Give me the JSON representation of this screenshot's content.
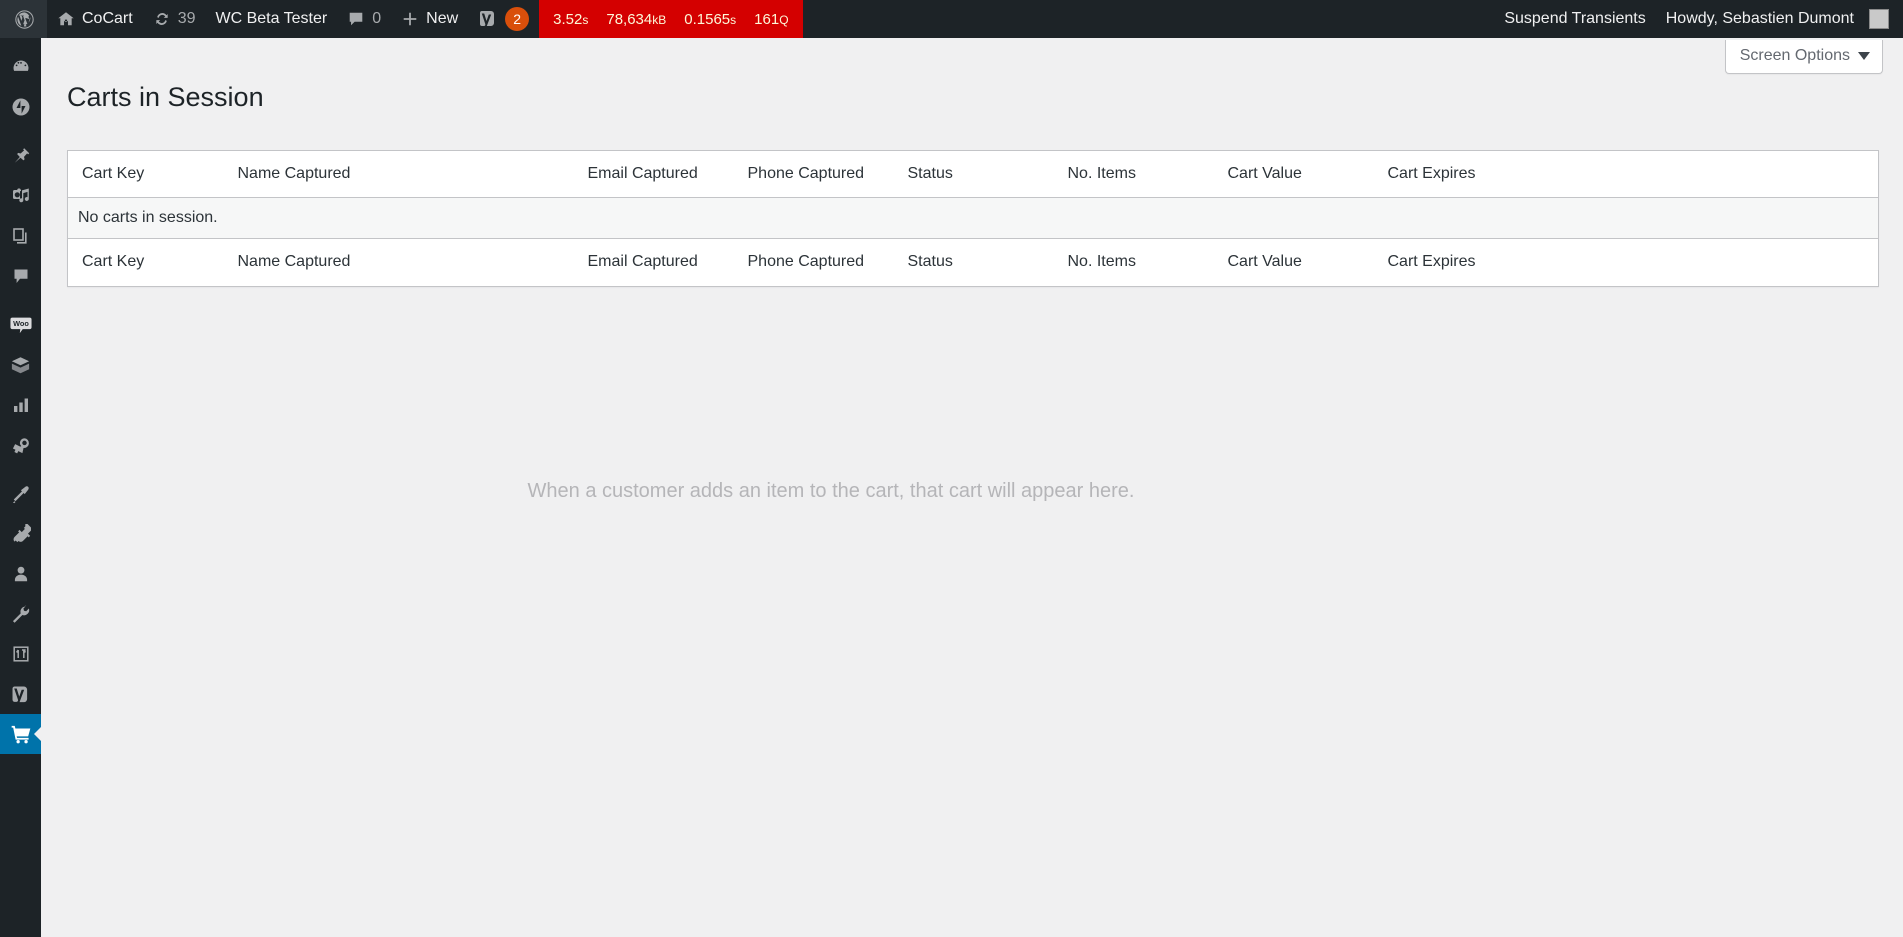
{
  "adminbar": {
    "wp_logo": "wordpress-logo-icon",
    "site_name": "CoCart",
    "home_icon": "home-icon",
    "updates": {
      "icon": "updates-icon",
      "count": "39"
    },
    "beta_tester": "WC Beta Tester",
    "comments": {
      "icon": "comment-bubble-icon",
      "count": "0"
    },
    "new_content": {
      "icon": "plus-icon",
      "label": "New"
    },
    "yoast": {
      "icon": "yoast-logo-icon",
      "badge": "2"
    },
    "debug": {
      "time": "3.52",
      "time_unit": "s",
      "memory": "78,634",
      "memory_unit": "kB",
      "db_time": "0.1565",
      "db_time_unit": "s",
      "queries": "161",
      "queries_unit": "Q",
      "bg_color": "#d40000",
      "text_color": "#fdf7d8"
    },
    "suspend_transients": "Suspend Transients",
    "howdy": "Howdy, Sebastien Dumont",
    "avatar": "user-avatar"
  },
  "sidebar": {
    "active_color": "#0073aa",
    "items": [
      {
        "name": "dashboard",
        "icon": "dashboard-gauge-icon",
        "current": false
      },
      {
        "name": "jetpack",
        "icon": "jetpack-icon",
        "current": false
      },
      {
        "name": "posts",
        "icon": "pin-icon",
        "current": false
      },
      {
        "name": "media",
        "icon": "media-camera-music-icon",
        "current": false
      },
      {
        "name": "pages",
        "icon": "pages-icon",
        "current": false
      },
      {
        "name": "comments",
        "icon": "comment-bubble-icon",
        "current": false
      },
      {
        "name": "woocommerce",
        "icon": "woo-bubble-icon",
        "current": false
      },
      {
        "name": "products",
        "icon": "product-box-icon",
        "current": false
      },
      {
        "name": "analytics",
        "icon": "bar-chart-icon",
        "current": false
      },
      {
        "name": "marketing",
        "icon": "megaphone-icon",
        "current": false
      },
      {
        "name": "appearance",
        "icon": "paintbrush-icon",
        "current": false
      },
      {
        "name": "plugins",
        "icon": "plug-icon",
        "current": false
      },
      {
        "name": "users",
        "icon": "user-icon",
        "current": false
      },
      {
        "name": "tools",
        "icon": "wrench-icon",
        "current": false
      },
      {
        "name": "settings",
        "icon": "sliders-settings-icon",
        "current": false
      },
      {
        "name": "yoast-seo",
        "icon": "yoast-logo-icon",
        "current": false
      },
      {
        "name": "cocart-carts",
        "icon": "shopping-cart-icon",
        "current": true
      }
    ]
  },
  "screen_meta": {
    "screen_options_label": "Screen Options",
    "caret_icon": "chevron-down-icon"
  },
  "page": {
    "title": "Carts in Session",
    "empty_message": "When a customer adds an item to the cart, that cart will appear here."
  },
  "table": {
    "columns": [
      {
        "key": "cart_key",
        "label": "Cart Key"
      },
      {
        "key": "name_captured",
        "label": "Name Captured"
      },
      {
        "key": "email_captured",
        "label": "Email Captured"
      },
      {
        "key": "phone_captured",
        "label": "Phone Captured"
      },
      {
        "key": "status",
        "label": "Status"
      },
      {
        "key": "no_items",
        "label": "No. Items"
      },
      {
        "key": "cart_value",
        "label": "Cart Value"
      },
      {
        "key": "cart_expires",
        "label": "Cart Expires"
      }
    ],
    "no_items_text": "No carts in session.",
    "rows": []
  }
}
